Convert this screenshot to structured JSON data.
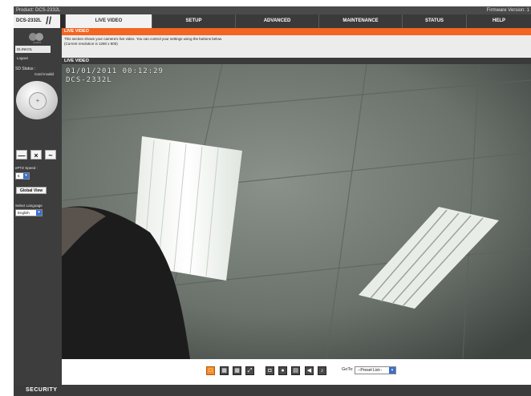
{
  "header": {
    "product": "Product: DCS-2332L",
    "firmware": "Firmware Version: 1",
    "model": "DCS-2332L"
  },
  "tabs": [
    {
      "label": "LIVE VIDEO",
      "active": true
    },
    {
      "label": "SETUP",
      "active": false
    },
    {
      "label": "ADVANCED",
      "active": false
    },
    {
      "label": "MAINTENANCE",
      "active": false
    },
    {
      "label": "STATUS",
      "active": false
    },
    {
      "label": "HELP",
      "active": false
    }
  ],
  "sidebar": {
    "logo_text": "mydlink",
    "user_link": "DLINKOL",
    "logout": "Logout",
    "sd_status": "SD Status :",
    "sd_value": "Card Invalid",
    "ptz_speed_label": "ePTZ Speed :",
    "ptz_speed_value": "5",
    "global_view": "Global View",
    "language_label": "Select Language",
    "language_value": "English"
  },
  "page": {
    "section_title": "LIVE VIDEO",
    "description_line1": "This section shows your camera's live video. You can control your settings using the buttons below.",
    "description_line2": "(Current resolution is 1280 x 800)",
    "live_header": "LIVE VIDEO"
  },
  "video": {
    "timestamp": "01/01/2011 00:12:29",
    "camera_name": "DCS-2332L"
  },
  "toolbar": {
    "goto_label": "GoTo:",
    "preset_value": "--Preset List--"
  },
  "footer": {
    "label": "SECURITY"
  },
  "colors": {
    "accent": "#f26522",
    "frame": "#3b3b3b",
    "select_arrow": "#3c6fcc"
  }
}
